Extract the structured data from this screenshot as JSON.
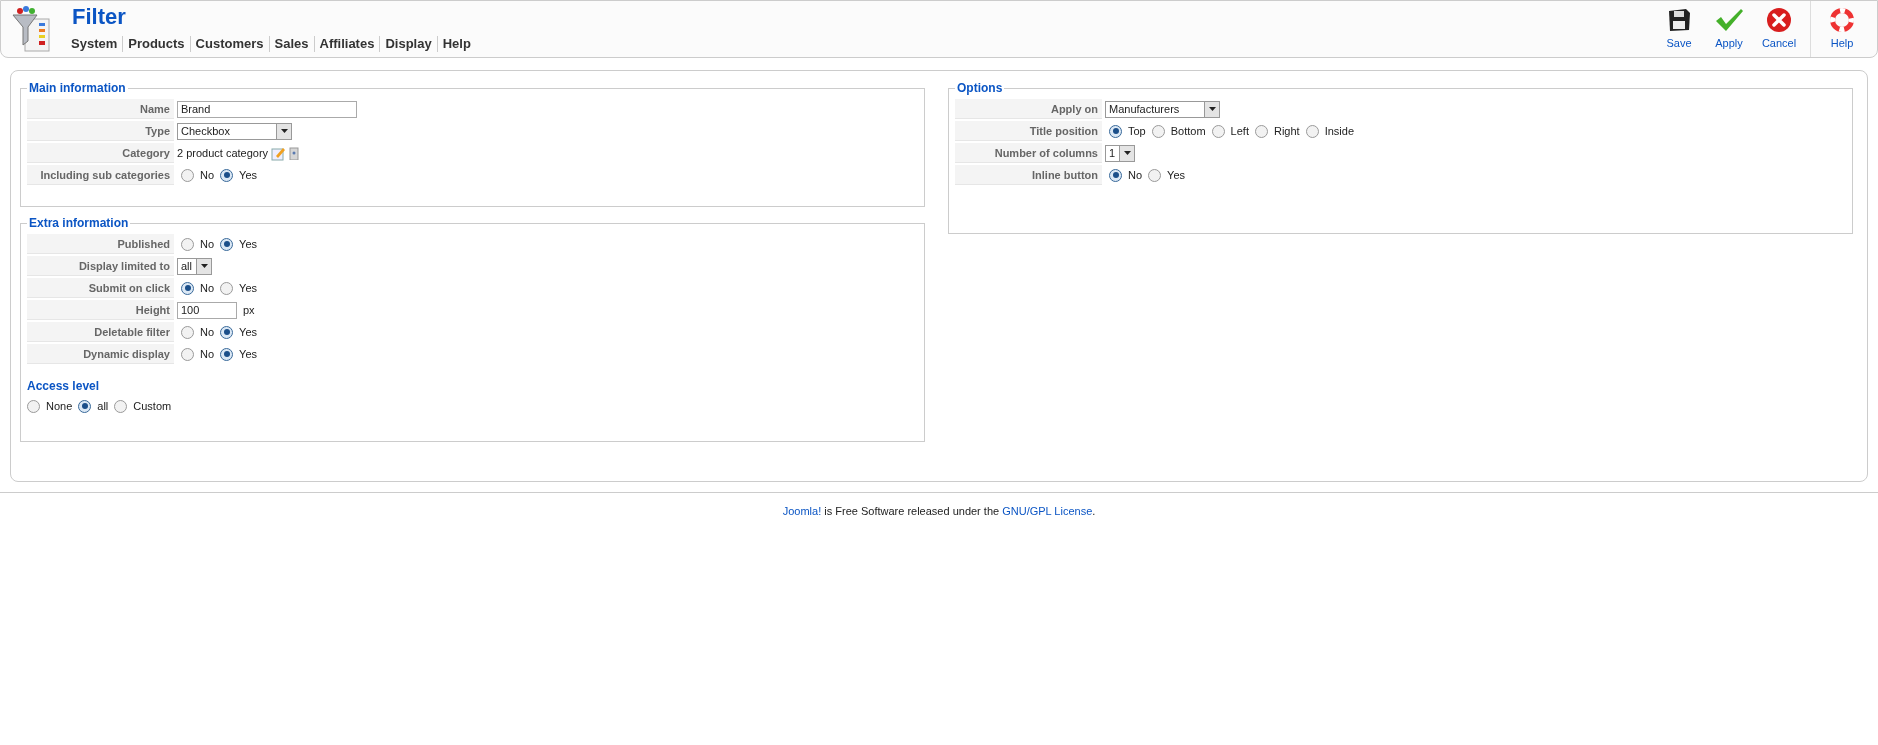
{
  "header": {
    "title": "Filter",
    "menu": [
      "System",
      "Products",
      "Customers",
      "Sales",
      "Affiliates",
      "Display",
      "Help"
    ],
    "toolbar": [
      {
        "kind": "save",
        "label": "Save"
      },
      {
        "kind": "apply",
        "label": "Apply"
      },
      {
        "kind": "cancel",
        "label": "Cancel"
      },
      {
        "kind": "help",
        "label": "Help"
      }
    ]
  },
  "main_information": {
    "legend": "Main information",
    "rows": [
      {
        "kind": "text",
        "label": "Name",
        "value": "Brand"
      },
      {
        "kind": "select",
        "label": "Type",
        "value": "Checkbox"
      },
      {
        "kind": "category",
        "label": "Category",
        "value": "2 product category"
      },
      {
        "kind": "radio",
        "label": "Including sub categories",
        "options": [
          {
            "label": "No",
            "selected": false
          },
          {
            "label": "Yes",
            "selected": true
          }
        ]
      }
    ]
  },
  "extra_information": {
    "legend": "Extra information",
    "rows": [
      {
        "kind": "radio",
        "label": "Published",
        "options": [
          {
            "label": "No",
            "selected": false
          },
          {
            "label": "Yes",
            "selected": true
          }
        ]
      },
      {
        "kind": "select",
        "label": "Display limited to",
        "value": "all"
      },
      {
        "kind": "radio",
        "label": "Submit on click",
        "options": [
          {
            "label": "No",
            "selected": true
          },
          {
            "label": "Yes",
            "selected": false
          }
        ]
      },
      {
        "kind": "text",
        "label": "Height",
        "value": "100",
        "unit": "px"
      },
      {
        "kind": "radio",
        "label": "Deletable filter",
        "options": [
          {
            "label": "No",
            "selected": false
          },
          {
            "label": "Yes",
            "selected": true
          }
        ]
      },
      {
        "kind": "radio",
        "label": "Dynamic display",
        "options": [
          {
            "label": "No",
            "selected": false
          },
          {
            "label": "Yes",
            "selected": true
          }
        ]
      }
    ],
    "access_level": {
      "title": "Access level",
      "options": [
        {
          "label": "None",
          "selected": false
        },
        {
          "label": "all",
          "selected": true
        },
        {
          "label": "Custom",
          "selected": false
        }
      ]
    }
  },
  "options": {
    "legend": "Options",
    "rows": [
      {
        "kind": "select",
        "label": "Apply on",
        "value": "Manufacturers"
      },
      {
        "kind": "radio",
        "label": "Title position",
        "options": [
          {
            "label": "Top",
            "selected": true
          },
          {
            "label": "Bottom",
            "selected": false
          },
          {
            "label": "Left",
            "selected": false
          },
          {
            "label": "Right",
            "selected": false
          },
          {
            "label": "Inside",
            "selected": false
          }
        ]
      },
      {
        "kind": "select",
        "label": "Number of columns",
        "value": "1"
      },
      {
        "kind": "radio",
        "label": "Inline button",
        "options": [
          {
            "label": "No",
            "selected": true
          },
          {
            "label": "Yes",
            "selected": false
          }
        ]
      }
    ]
  },
  "footer": {
    "parts": [
      {
        "kind": "link",
        "text": "Joomla!"
      },
      {
        "kind": "text",
        "text": "is Free Software released under the"
      },
      {
        "kind": "link",
        "text": "GNU/GPL License"
      },
      {
        "kind": "text",
        "text": "."
      }
    ]
  }
}
